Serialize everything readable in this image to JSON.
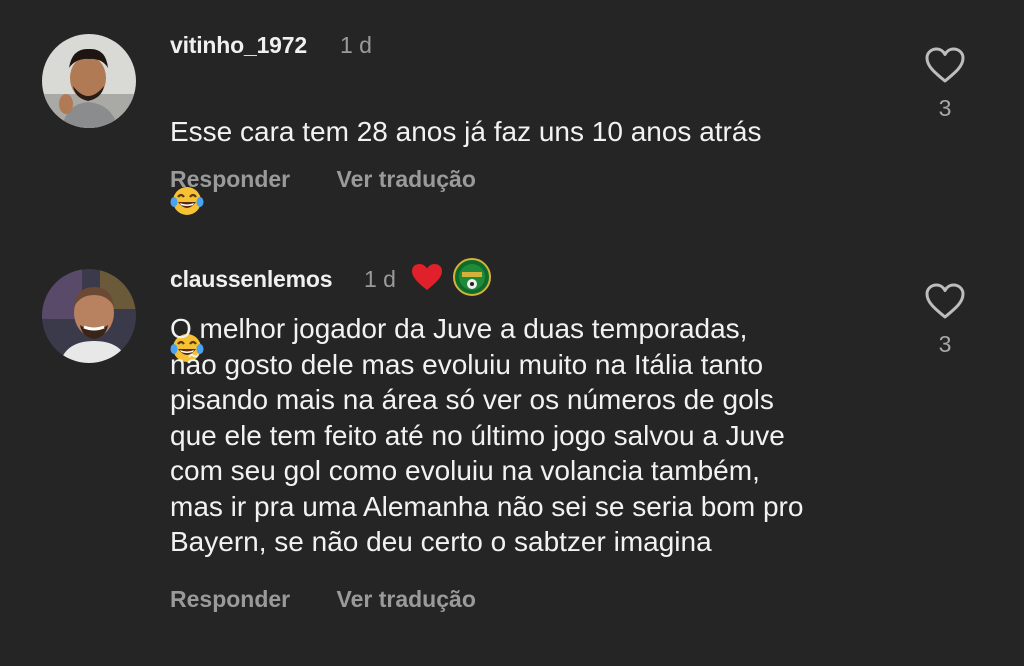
{
  "comments": [
    {
      "username": "vitinho_1972",
      "time": "1 d",
      "text": "Esse cara tem 28 anos já faz uns 10 anos atrás",
      "emoji": "laughing-tears-emoji",
      "reply_label": "Responder",
      "translate_label": "Ver tradução",
      "likes": "3",
      "avatar": "avatar-photo"
    },
    {
      "username": "claussenlemos",
      "time": "1 d",
      "badges": [
        "red-heart-icon",
        "team-badge-icon"
      ],
      "text": "O melhor jogador da Juve a duas temporadas,\nnão gosto dele mas evoluiu muito na Itália tanto\npisando mais na área só ver os números de gols\nque ele tem feito até no último jogo salvou a Juve\ncom seu gol como evoluiu na volancia também,\nmas ir pra uma Alemanha não sei se seria bom pro\nBayern, se não deu certo o sabtzer imagina",
      "reply_label": "Responder",
      "translate_label": "Ver tradução",
      "likes": "3",
      "avatar": "avatar-photo"
    }
  ],
  "colors": {
    "background": "#252525",
    "text": "#f2f2f2",
    "muted": "#9a9a9a",
    "heart_red": "#e0202a"
  }
}
